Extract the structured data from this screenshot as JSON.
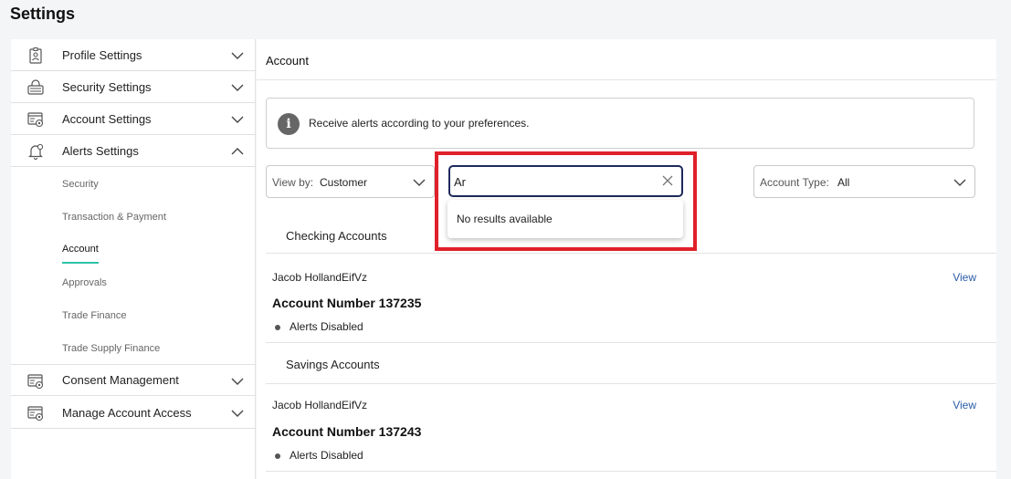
{
  "page": {
    "title": "Settings"
  },
  "sidebar": {
    "items": [
      {
        "label": "Profile Settings",
        "icon": "profile-id-icon",
        "expanded": false
      },
      {
        "label": "Security Settings",
        "icon": "keyboard-lock-icon",
        "expanded": false
      },
      {
        "label": "Account Settings",
        "icon": "account-gear-icon",
        "expanded": false
      },
      {
        "label": "Alerts Settings",
        "icon": "bell-gear-icon",
        "expanded": true
      },
      {
        "label": "Consent Management",
        "icon": "account-gear-icon",
        "expanded": false
      },
      {
        "label": "Manage Account Access",
        "icon": "account-gear-icon",
        "expanded": false
      }
    ],
    "alerts_sub": [
      "Security",
      "Transaction & Payment",
      "Account",
      "Approvals",
      "Trade Finance",
      "Trade Supply Finance"
    ],
    "active_sub": "Account"
  },
  "main": {
    "title": "Account",
    "info": "Receive alerts according to your preferences.",
    "view_by": {
      "label": "View by:",
      "value": "Customer"
    },
    "search": {
      "value": "Ar",
      "no_results": "No results available"
    },
    "account_type": {
      "label": "Account Type:",
      "value": "All"
    },
    "sections": [
      {
        "label": "Checking Accounts",
        "holder": "Jacob HollandEifVz",
        "view": "View",
        "account": "Account Number 137235",
        "status": "Alerts Disabled"
      },
      {
        "label": "Savings Accounts",
        "holder": "Jacob HollandEifVz",
        "view": "View",
        "account": "Account Number 137243",
        "status": "Alerts Disabled"
      }
    ]
  },
  "colors": {
    "accent_underline": "#2ec4a8",
    "highlight": "#e0202a",
    "link": "#2a5ca8",
    "search_border": "#1d2a5b"
  }
}
